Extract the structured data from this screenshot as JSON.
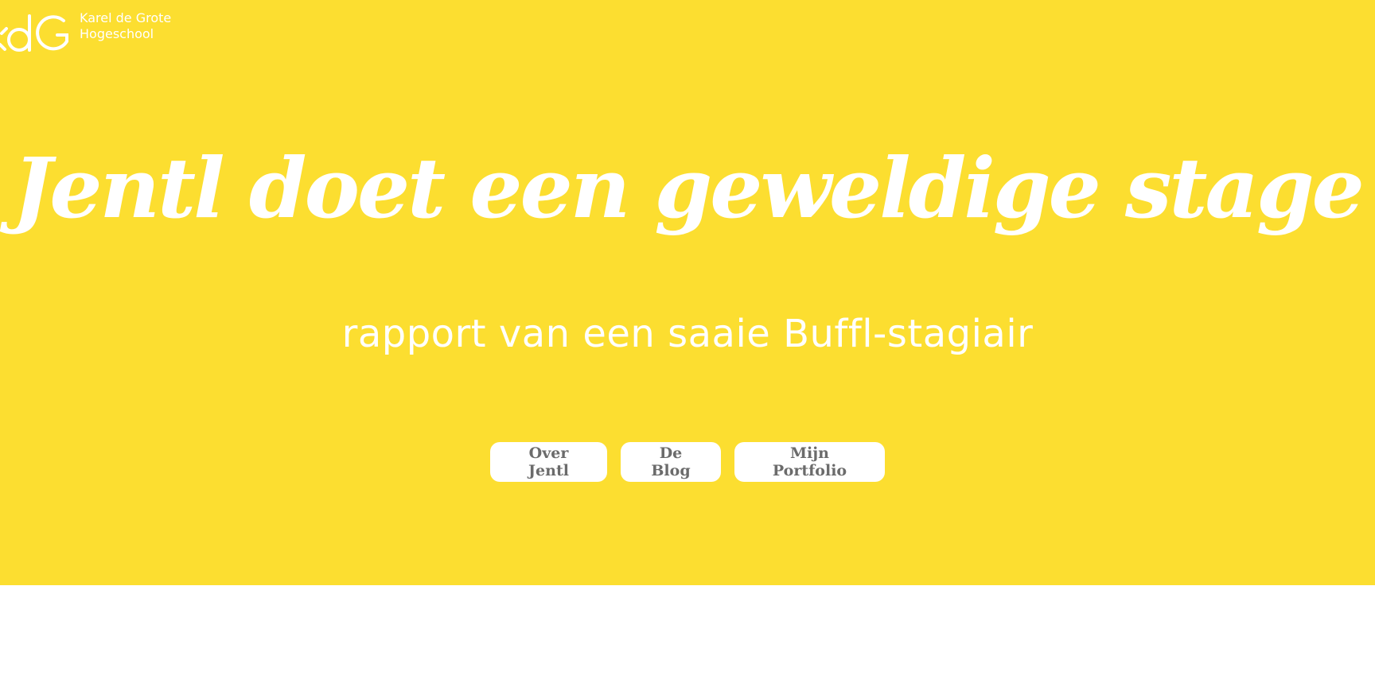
{
  "logo": {
    "line1": "Karel de Grote",
    "line2": "Hogeschool"
  },
  "hero": {
    "title": "Jentl doet een geweldige stage",
    "subtitle": "rapport van een saaie Buffl-stagiair",
    "background_color": "#FCDE30"
  },
  "nav": {
    "buttons": [
      {
        "label": "Over Jentl"
      },
      {
        "label": "De Blog"
      },
      {
        "label": "Mijn Portfolio"
      }
    ]
  }
}
